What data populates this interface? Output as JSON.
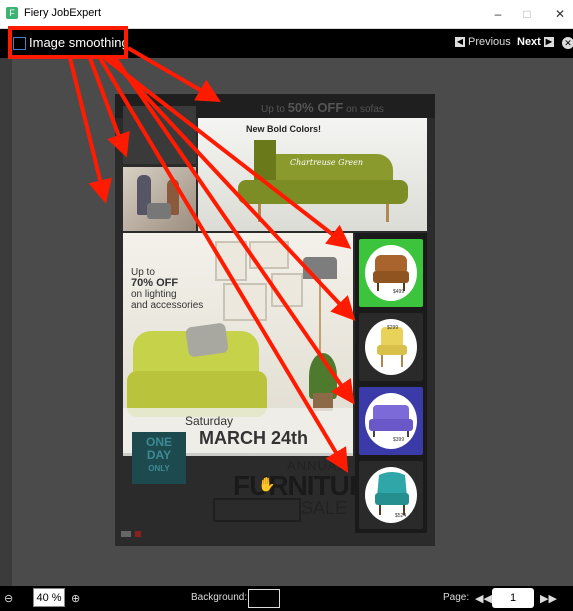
{
  "window": {
    "title": "Fiery JobExpert",
    "app_icon": "fiery-app-icon",
    "minimize": "–",
    "maximize": "□",
    "close": "✕"
  },
  "toolbar": {
    "image_smoothing_label": "Image smoothing",
    "image_smoothing_checked": false,
    "previous_label": "Previous",
    "next_label": "Next",
    "previous_icon": "arrow-left-box-icon",
    "next_icon": "arrow-right-box-icon",
    "close_icon": "close-circle-icon"
  },
  "document": {
    "banner_prefix": "Up to",
    "banner_offer": "50% OFF",
    "banner_suffix": "on sofas",
    "bold_colors": "New Bold Colors!",
    "sofa_label": "Chartreuse Green",
    "promo_line1": "Up to",
    "promo_line2": "70% OFF",
    "promo_line3": "on lighting",
    "promo_line4": "and accessories",
    "saturday": "Saturday",
    "march": "MARCH 24th",
    "one": "ONE",
    "day": "DAY",
    "only": "ONLY",
    "annual": "ANNUAL",
    "furniture": "FURNITURE",
    "sale": "SALE",
    "tiles": [
      {
        "price": "$499",
        "bg": "#3cc43c",
        "item": "armchair-brown"
      },
      {
        "price": "$299",
        "bg": "#2a2a2a",
        "item": "chair-yellow"
      },
      {
        "price": "$399",
        "bg": "#3a3aa8",
        "item": "armchair-purple"
      },
      {
        "price": "$524",
        "bg": "#2a2a2a",
        "item": "wingchair-teal"
      }
    ]
  },
  "annotation": {
    "highlight_color": "#ff1b00"
  },
  "status_bar": {
    "zoom_value": "40 %",
    "background_label": "Background:",
    "page_label": "Page:",
    "page_value": "1",
    "zoom_out_icon": "zoom-out-icon",
    "zoom_in_icon": "zoom-in-icon",
    "prev_page_icon": "double-chevron-left-icon",
    "next_page_icon": "double-chevron-right-icon"
  }
}
